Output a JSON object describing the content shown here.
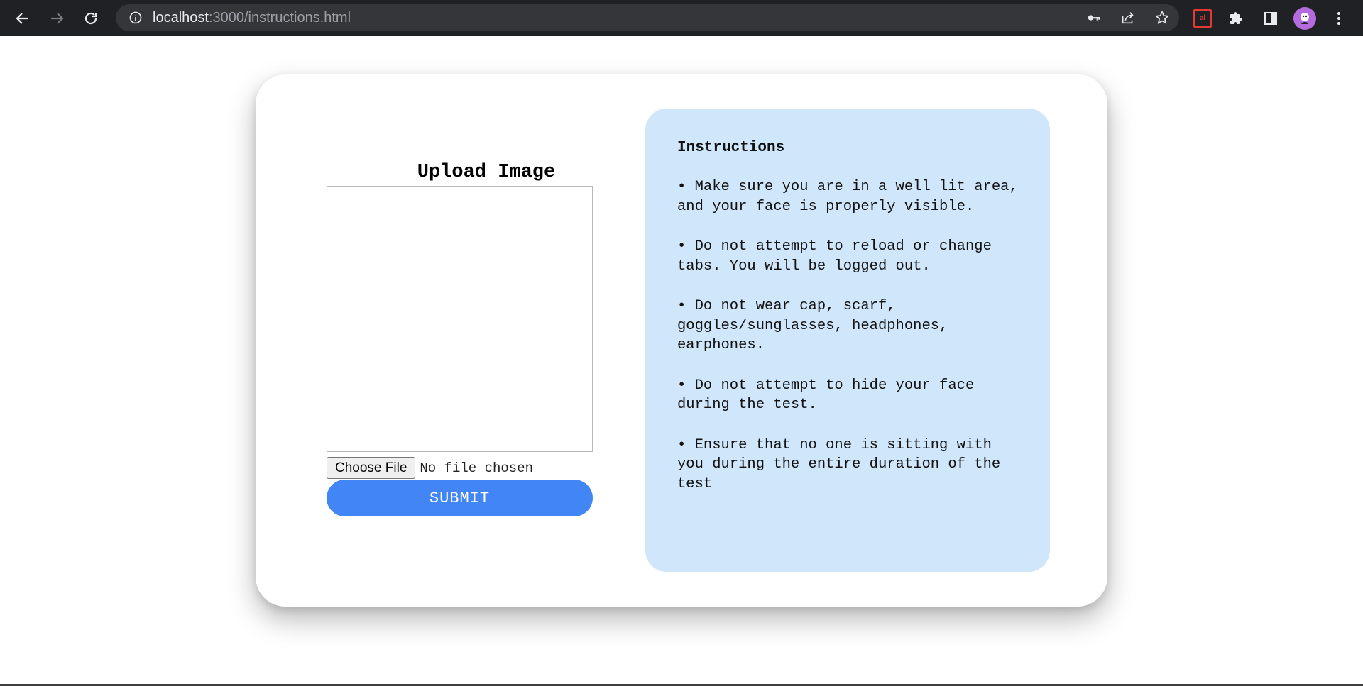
{
  "browser": {
    "url_host": "localhost",
    "url_rest": ":3000/instructions.html",
    "icons": {
      "back": "arrow-left-icon",
      "forward": "arrow-right-icon",
      "reload": "reload-icon",
      "info": "info-icon",
      "key": "key-icon",
      "share": "share-icon",
      "star": "star-icon",
      "extension": "extension-icon",
      "puzzle": "puzzle-icon",
      "sidepanel": "side-panel-icon",
      "menu": "kebab-menu-icon"
    },
    "ext_badge": "al"
  },
  "upload": {
    "title": "Upload Image",
    "choose_file_label": "Choose File",
    "no_file_text": "No file chosen",
    "submit_label": "SUBMIT"
  },
  "instructions": {
    "title": "Instructions",
    "items": [
      "• Make sure you are in a well lit area, and your face is properly visible.",
      "• Do not attempt to reload or change tabs. You will be logged out.",
      "• Do not wear cap, scarf, goggles/sunglasses, headphones, earphones.",
      "• Do not attempt to hide your face during the test.",
      "• Ensure that no one is sitting with you during the entire duration of the test"
    ]
  },
  "colors": {
    "accent": "#4285f4",
    "panel": "#d0e6fb",
    "chrome": "#202124"
  }
}
